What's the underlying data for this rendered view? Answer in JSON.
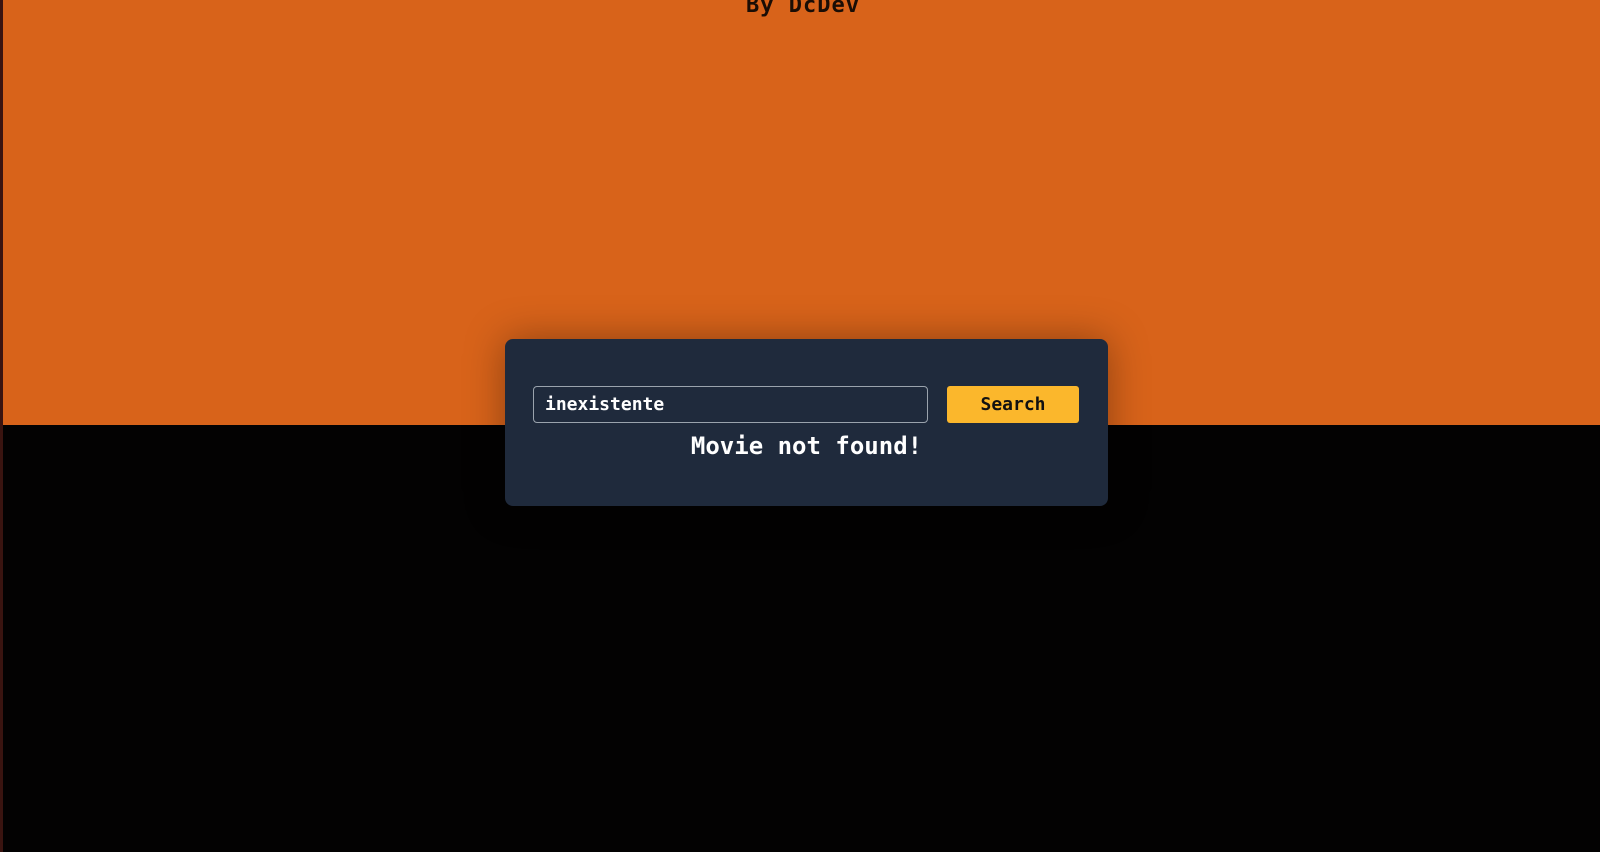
{
  "header": {
    "byline": "By DcDev"
  },
  "search": {
    "value": "inexistente",
    "button_label": "Search"
  },
  "result": {
    "message": "Movie not found!"
  },
  "colors": {
    "top_band": "#d8631a",
    "background": "#030202",
    "card": "#1f2a3c",
    "button": "#fbb72c"
  }
}
